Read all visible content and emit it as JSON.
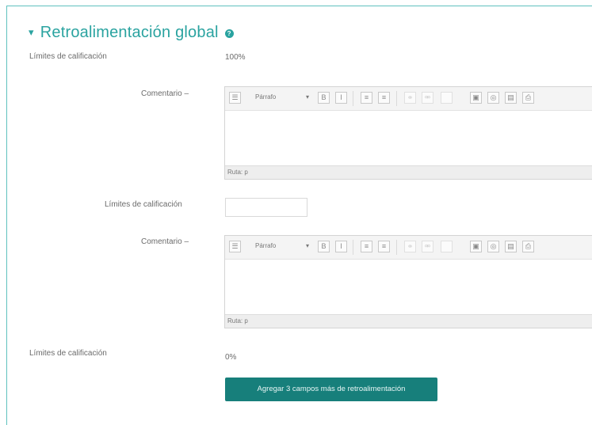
{
  "section": {
    "title": "Retroalimentación global"
  },
  "rows": [
    {
      "label": "Límites de calificación",
      "value": "100%"
    },
    {
      "label": "Comentario"
    },
    {
      "label": "Límites de calificación",
      "input_value": ""
    },
    {
      "label": "Comentario"
    },
    {
      "label": "Límites de calificación",
      "value": "0%"
    }
  ],
  "editor": {
    "paragraph_label": "Párrafo",
    "path_text": "Ruta: p",
    "tool_icons": [
      "show-more-icon",
      "bold-icon",
      "italic-icon",
      "bullet-list-icon",
      "numbered-list-icon",
      "link-icon",
      "unlink-icon",
      "image-icon",
      "media-icon",
      "manage-files-icon",
      "record-icon"
    ]
  },
  "button": {
    "label": "Agregar 3 campos más de retroalimentación"
  },
  "colors": {
    "accent": "#2aa3a0",
    "button_bg": "#177f7b",
    "frame": "#5fc1bf"
  }
}
